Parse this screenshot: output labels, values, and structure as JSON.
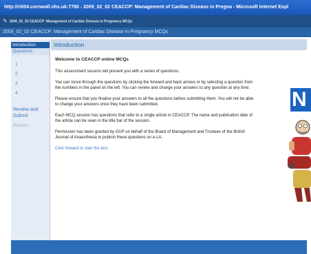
{
  "window": {
    "title": "http://riti04.cornwall.nhs.uk:7780 - 2009_02_02 CEACCP: Management of Cardiac Disease in Pregna - Microsoft Internet Expl",
    "tab_label": "2009_02_02 CEACCP: Management of Cardiac Disease in Pregnancy MCQs",
    "subtitle": "2009_02_02 CEACCP: Management of Cardiac Disease in Pregnancy MCQs"
  },
  "sidebar": {
    "header": "Introduction",
    "questions_label": "Questions",
    "items": [
      "1",
      "2",
      "3",
      "4"
    ],
    "review_label": "Review and Submit",
    "results_label": "Results"
  },
  "main": {
    "heading": "Introduction",
    "welcome": "Welcome to CEACCP online MCQs",
    "paragraphs": [
      "This assessment session will present you with a series of questions.",
      "You can move through the questions by clicking the forward and back arrows or by selecting a question from the numbers in the panel on the left. You can review and change your answers to any question at any time.",
      "Please ensure that you finalise your answers to all the questions before submitting them. You will not be able to change your answers once they have been submitted.",
      "Each MCQ session has questions that refer to a single article in CEACCP. The name and publication date of the article can be seen in the title bar of the session.",
      "Permission has been granted by OUP on behalf of the Board of Management and Trustees of the British Journal of Anaesthesia to publish these questions on e-LA."
    ],
    "forward_link": "Click forward to start the test."
  },
  "ad": {
    "letter": "N"
  }
}
